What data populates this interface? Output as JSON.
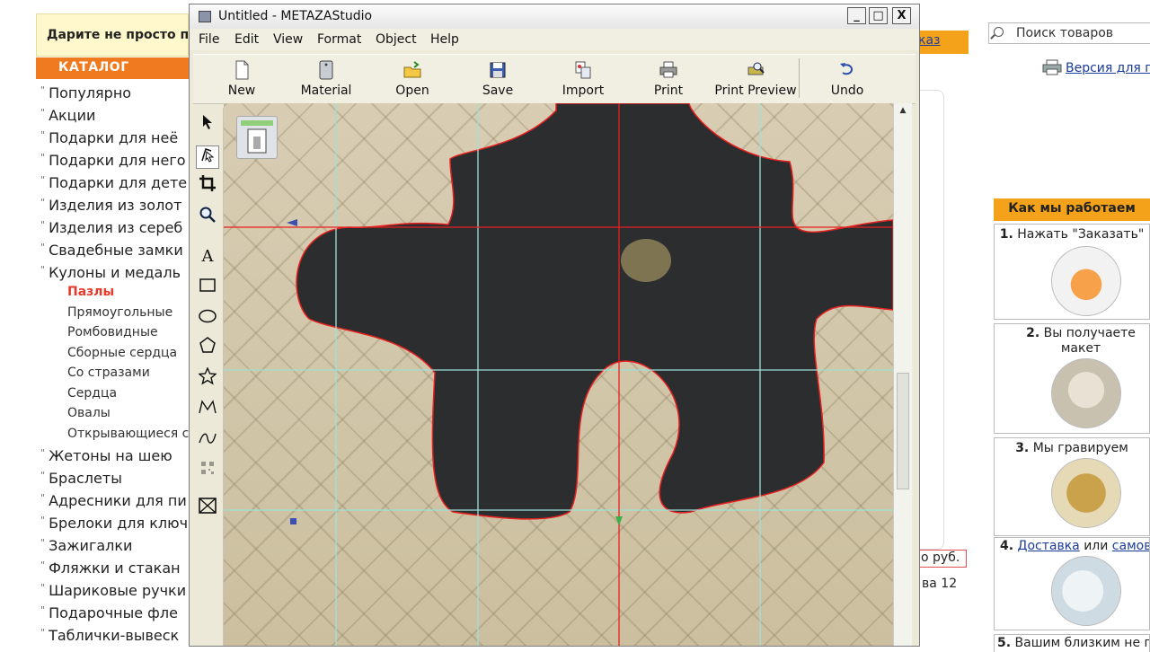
{
  "background": {
    "promo_text": "Дарите не просто по",
    "catalog_title": "КАТАЛОГ",
    "categories": [
      "Популярно",
      "Акции",
      "Подарки для неё",
      "Подарки для него",
      "Подарки для дете",
      "Изделия из золот",
      "Изделия из сереб",
      "Свадебные замки",
      "Кулоны и медаль"
    ],
    "subcategories": [
      "Пазлы",
      "Прямоугольные",
      "Ромбовидные",
      "Сборные сердца",
      "Со стразами",
      "Сердца",
      "Овалы",
      "Открывающиеся с"
    ],
    "categories_more": [
      "Жетоны на шею",
      "Браслеты",
      "Адресники для пи",
      "Брелоки для ключ",
      "Зажигалки",
      "Фляжки и стакан",
      "Шариковые ручки",
      "Подарочные фле",
      "Таблички-вывеск"
    ],
    "order_link": "каз",
    "search_placeholder": "Поиск товаров",
    "print_version": "Версия для пе",
    "how_title": "Как мы работаем",
    "steps": [
      {
        "num": "1.",
        "text": "Нажать \"Заказать\""
      },
      {
        "num": "2.",
        "text": "Вы получаете макет"
      },
      {
        "num": "3.",
        "text": "Мы гравируем"
      },
      {
        "num": "4.",
        "link1": "Доставка",
        "mid": " или ",
        "link2": "самовы"
      },
      {
        "num": "5.",
        "text": "Вашим близким не пр"
      }
    ],
    "price_text": "о руб.",
    "address_text": "ва 12"
  },
  "window": {
    "title": "Untitled - METAZAStudio",
    "controls": {
      "minimize": "_",
      "maximize": "□",
      "close": "X"
    },
    "menu": [
      "File",
      "Edit",
      "View",
      "Format",
      "Object",
      "Help"
    ],
    "toolbar": [
      {
        "label": "New",
        "icon": "new-document-icon"
      },
      {
        "label": "Material",
        "icon": "material-icon"
      },
      {
        "label": "Open",
        "icon": "open-folder-icon"
      },
      {
        "label": "Save",
        "icon": "save-disk-icon"
      },
      {
        "label": "Import",
        "icon": "import-icon"
      },
      {
        "label": "Print",
        "icon": "printer-icon"
      },
      {
        "label": "Print Preview",
        "icon": "print-preview-icon"
      },
      {
        "label": "Undo",
        "icon": "undo-arrow-icon"
      }
    ],
    "tools": [
      "select-arrow-icon",
      "node-edit-icon",
      "crop-icon",
      "zoom-icon",
      "text-tool-icon",
      "rectangle-tool-icon",
      "ellipse-tool-icon",
      "polygon-tool-icon",
      "star-tool-icon",
      "polyline-tool-icon",
      "curve-tool-icon",
      "qr-code-icon",
      "image-frame-icon"
    ],
    "colors": {
      "guide": "#9fe0d8",
      "selection": "#e82020",
      "piece": "#2b2d2f"
    }
  }
}
